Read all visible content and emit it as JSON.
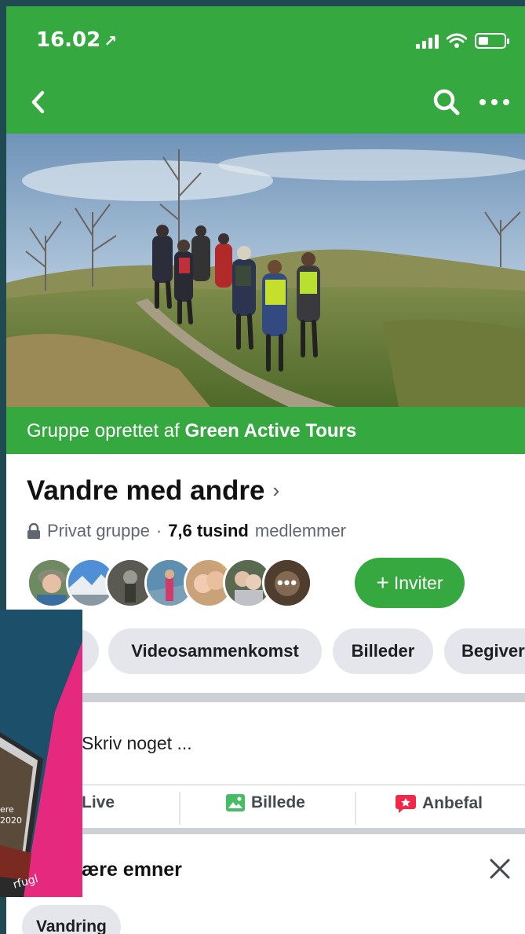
{
  "status_bar": {
    "time": "16.02",
    "location_glyph": "↗"
  },
  "nav": {
    "back_icon": "chevron-left-icon",
    "search_icon": "search-icon",
    "more_icon": "more-horizontal-icon"
  },
  "cover": {
    "description": "hikers"
  },
  "group": {
    "created_by_prefix": "Gruppe oprettet af",
    "created_by_name": "Green Active Tours",
    "name": "Vandre med andre",
    "name_chevron": "›",
    "privacy": "Privat gruppe",
    "separator": "·",
    "member_count": "7,6 tusind",
    "member_label": "medlemmer",
    "more_members_glyph": "•••",
    "invite_plus": "+",
    "invite_label": "Inviter"
  },
  "tabs": [
    "Videosammenkomst",
    "Billeder",
    "Begiver"
  ],
  "composer": {
    "placeholder": "Skriv noget ..."
  },
  "actions": {
    "live": "Live",
    "photo": "Billede",
    "recommend": "Anbefal"
  },
  "topics": {
    "title": "ære emner",
    "chip": "Vandring"
  },
  "overlay": {
    "poster_text_1": "ere",
    "poster_text_2": "2020",
    "poster_text_3": "rfugl"
  },
  "colors": {
    "brand_green": "#36a840",
    "chip_gray": "#e4e6eb",
    "divider": "#cdd0d4",
    "overlay_teal": "#1b4f6a",
    "overlay_pink": "#e4297f",
    "photo_icon_green": "#45bd62",
    "recommend_red": "#f0284a"
  }
}
